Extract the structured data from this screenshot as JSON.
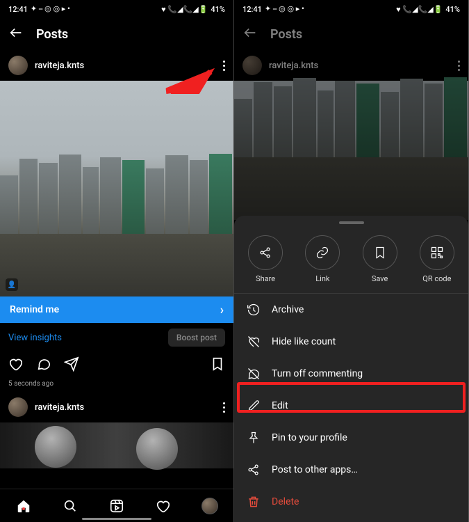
{
  "status": {
    "time": "12:41",
    "battery": "41%"
  },
  "header": {
    "title": "Posts"
  },
  "user": {
    "name": "raviteja.knts"
  },
  "remind": {
    "label": "Remind me"
  },
  "insights": {
    "view": "View insights",
    "boost": "Boost post"
  },
  "timestamp": "5 seconds ago",
  "sheet": {
    "circles": [
      {
        "label": "Share"
      },
      {
        "label": "Link"
      },
      {
        "label": "Save"
      },
      {
        "label": "QR code"
      }
    ],
    "items": [
      {
        "label": "Archive"
      },
      {
        "label": "Hide like count"
      },
      {
        "label": "Turn off commenting"
      },
      {
        "label": "Edit"
      },
      {
        "label": "Pin to your profile"
      },
      {
        "label": "Post to other apps…"
      },
      {
        "label": "Delete"
      }
    ]
  }
}
